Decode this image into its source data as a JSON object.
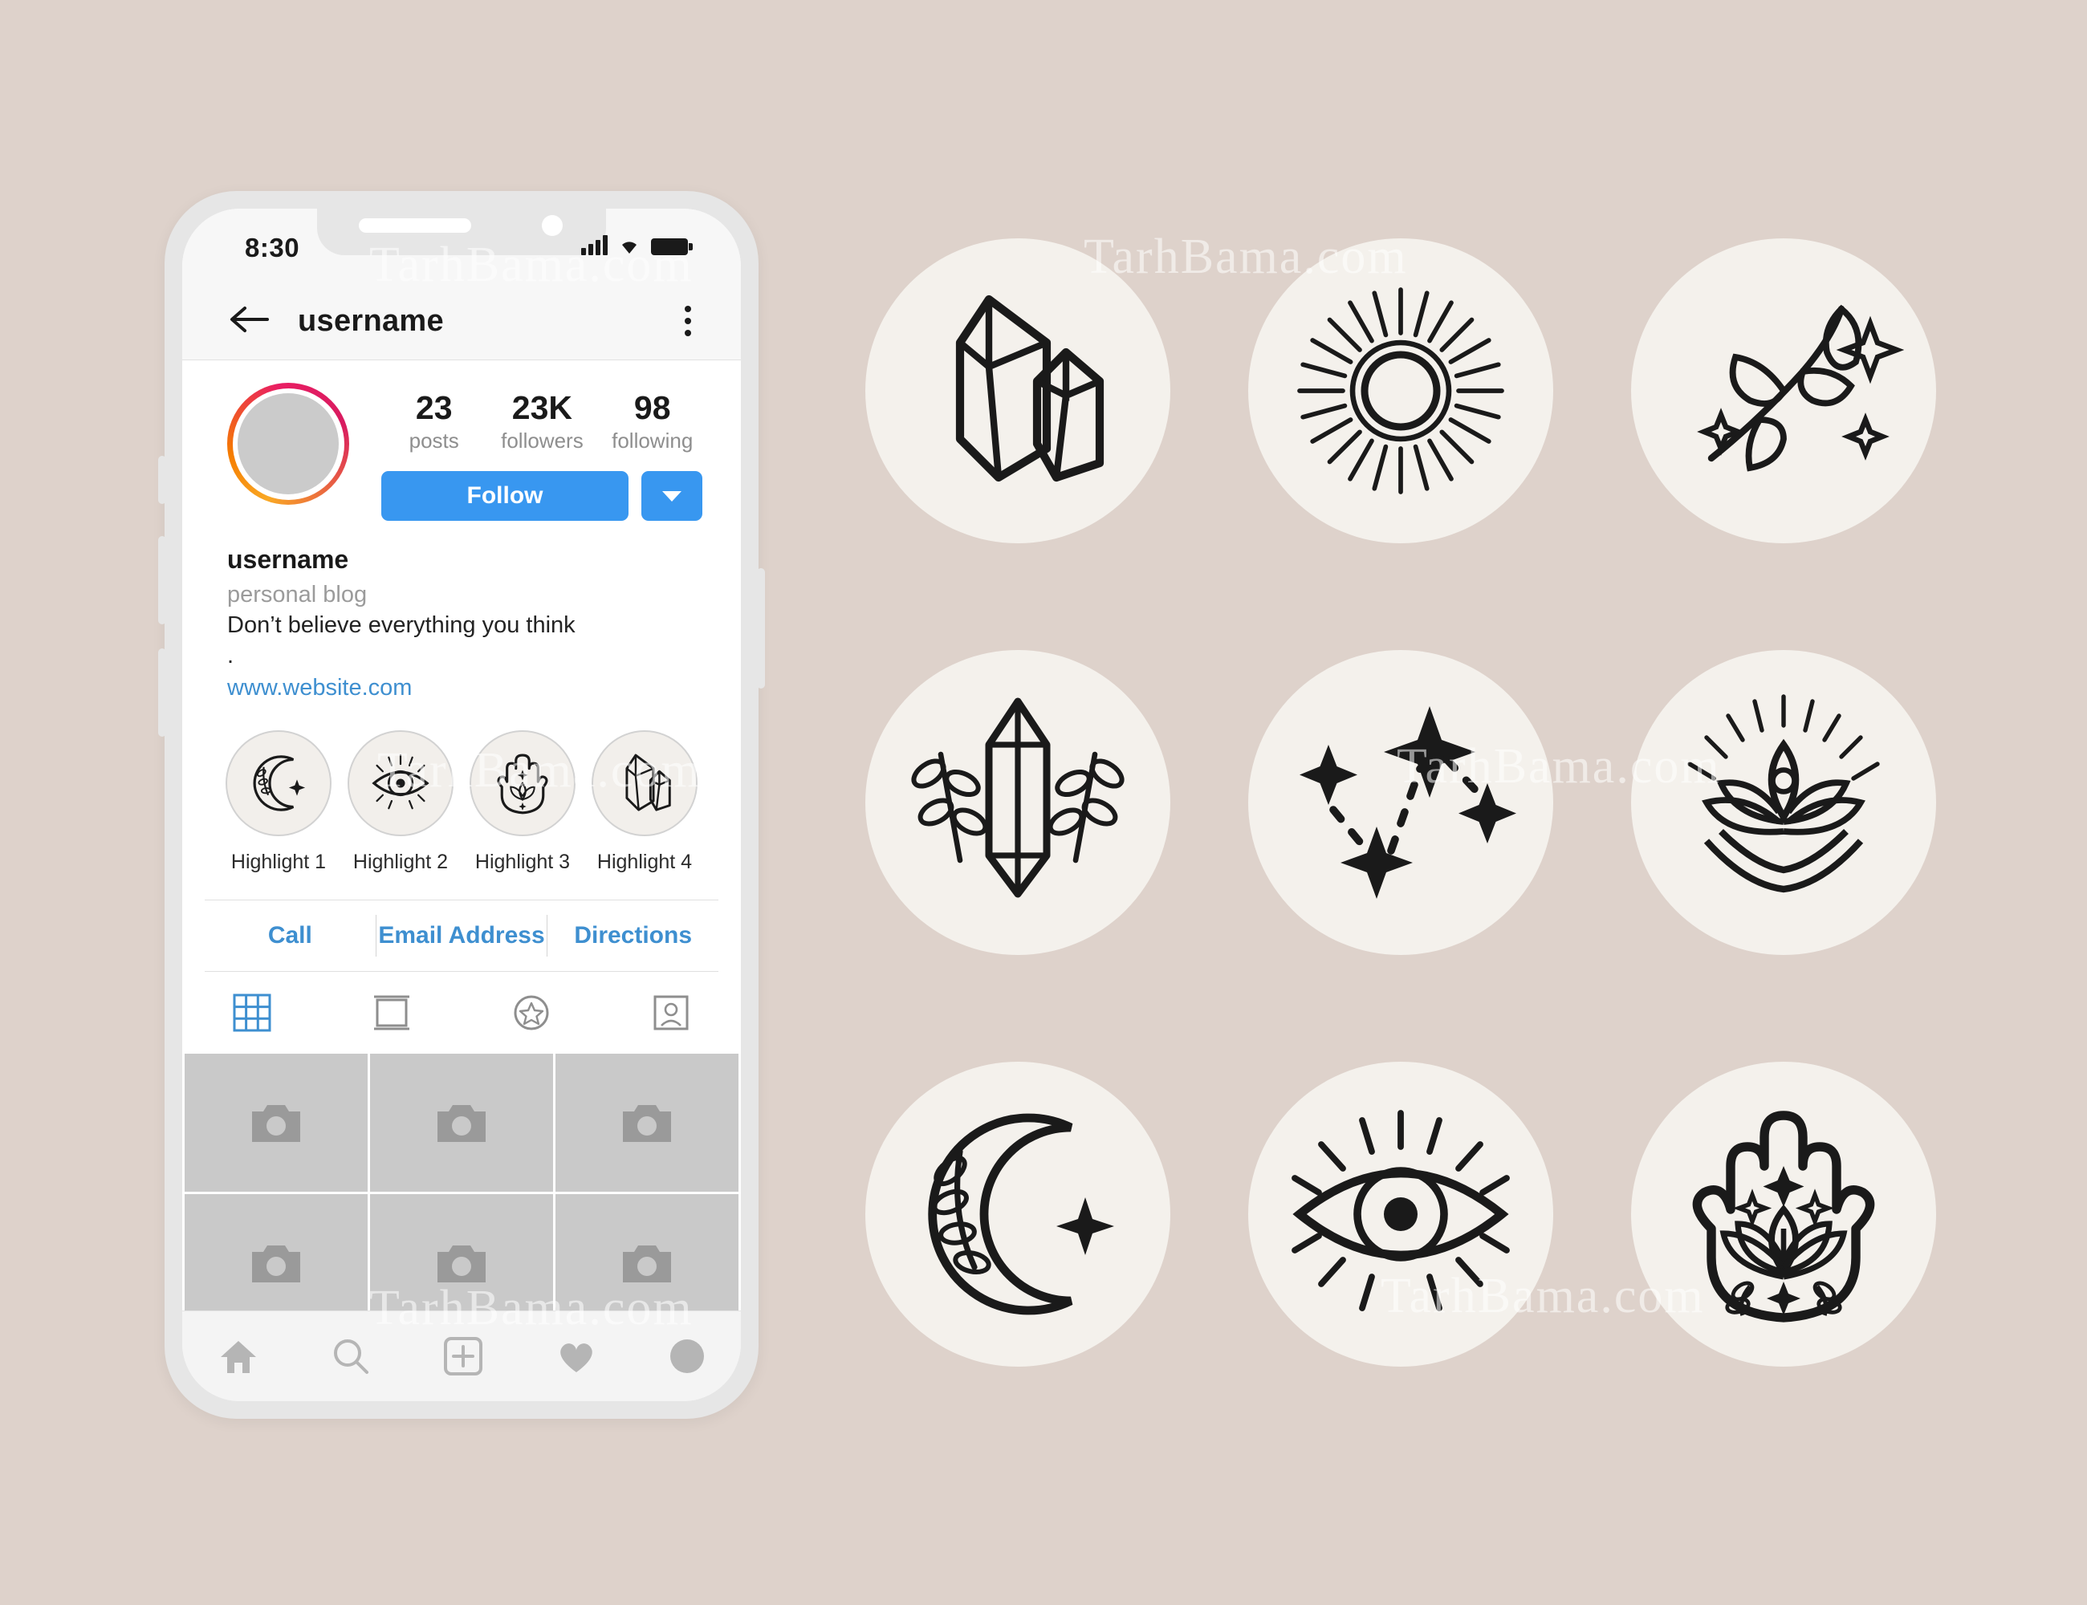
{
  "watermark": {
    "text": "TarhBama.com",
    "occurrences": 6
  },
  "colors": {
    "page_background": "#ded2cb",
    "phone_body": "#e6e6e6",
    "screen": "#ffffff",
    "accent_blue": "#3897f0",
    "link_blue": "#3e8fd0",
    "highlight_circle": "#f2efeb",
    "icon_circle": "#f4f1ec",
    "ink": "#1a1a1a",
    "muted_text": "#8e8e8e",
    "photo_placeholder": "#c9c9c9",
    "ring_gradient_start": "#f9a825",
    "ring_gradient_end": "#d81b60"
  },
  "phone": {
    "statusbar": {
      "time": "8:30",
      "icons": [
        "signal-bars-icon",
        "wifi-icon",
        "battery-icon"
      ]
    },
    "navbar": {
      "back_icon": "back-arrow-icon",
      "title": "username",
      "menu_icon": "more-vertical-icon"
    },
    "profile": {
      "avatar_label": "profile-photo",
      "stats": [
        {
          "value": "23",
          "label": "posts"
        },
        {
          "value": "23K",
          "label": "followers"
        },
        {
          "value": "98",
          "label": "following"
        }
      ],
      "follow_button": "Follow",
      "follow_more_icon": "chevron-down-icon"
    },
    "bio": {
      "name": "username",
      "category": "personal blog",
      "line1": "Don’t believe everything you think",
      "line2": ".",
      "website": "www.website.com"
    },
    "highlights": [
      {
        "label": "Highlight 1",
        "icon": "crescent-moon-icon"
      },
      {
        "label": "Highlight 2",
        "icon": "eye-icon"
      },
      {
        "label": "Highlight 3",
        "icon": "hamsa-hand-icon"
      },
      {
        "label": "Highlight 4",
        "icon": "crystals-icon"
      }
    ],
    "contact_buttons": [
      "Call",
      "Email Address",
      "Directions"
    ],
    "tabs": [
      {
        "icon": "grid-icon",
        "active": true
      },
      {
        "icon": "feed-icon",
        "active": false
      },
      {
        "icon": "star-icon",
        "active": false
      },
      {
        "icon": "tagged-icon",
        "active": false
      }
    ],
    "photo_grid": {
      "placeholder_icon": "camera-icon",
      "rows": 2,
      "columns": 3
    },
    "bottom_nav": [
      {
        "icon": "home-icon"
      },
      {
        "icon": "search-icon"
      },
      {
        "icon": "add-icon"
      },
      {
        "icon": "heart-icon"
      },
      {
        "icon": "profile-avatar-icon"
      }
    ]
  },
  "icon_grid": {
    "items": [
      {
        "icon": "crystals-icon",
        "name": "Crystals"
      },
      {
        "icon": "sun-rays-icon",
        "name": "Sun with rays"
      },
      {
        "icon": "leaf-branch-sparkle-icon",
        "name": "Leaf branch with sparkles"
      },
      {
        "icon": "crystal-botanical-icon",
        "name": "Crystal with botanicals"
      },
      {
        "icon": "constellation-icon",
        "name": "Constellation"
      },
      {
        "icon": "lotus-third-eye-icon",
        "name": "Lotus third eye"
      },
      {
        "icon": "crescent-moon-icon",
        "name": "Crescent moon with leaves"
      },
      {
        "icon": "eye-icon",
        "name": "Eye"
      },
      {
        "icon": "hamsa-hand-icon",
        "name": "Hamsa hand with lotus"
      }
    ]
  }
}
